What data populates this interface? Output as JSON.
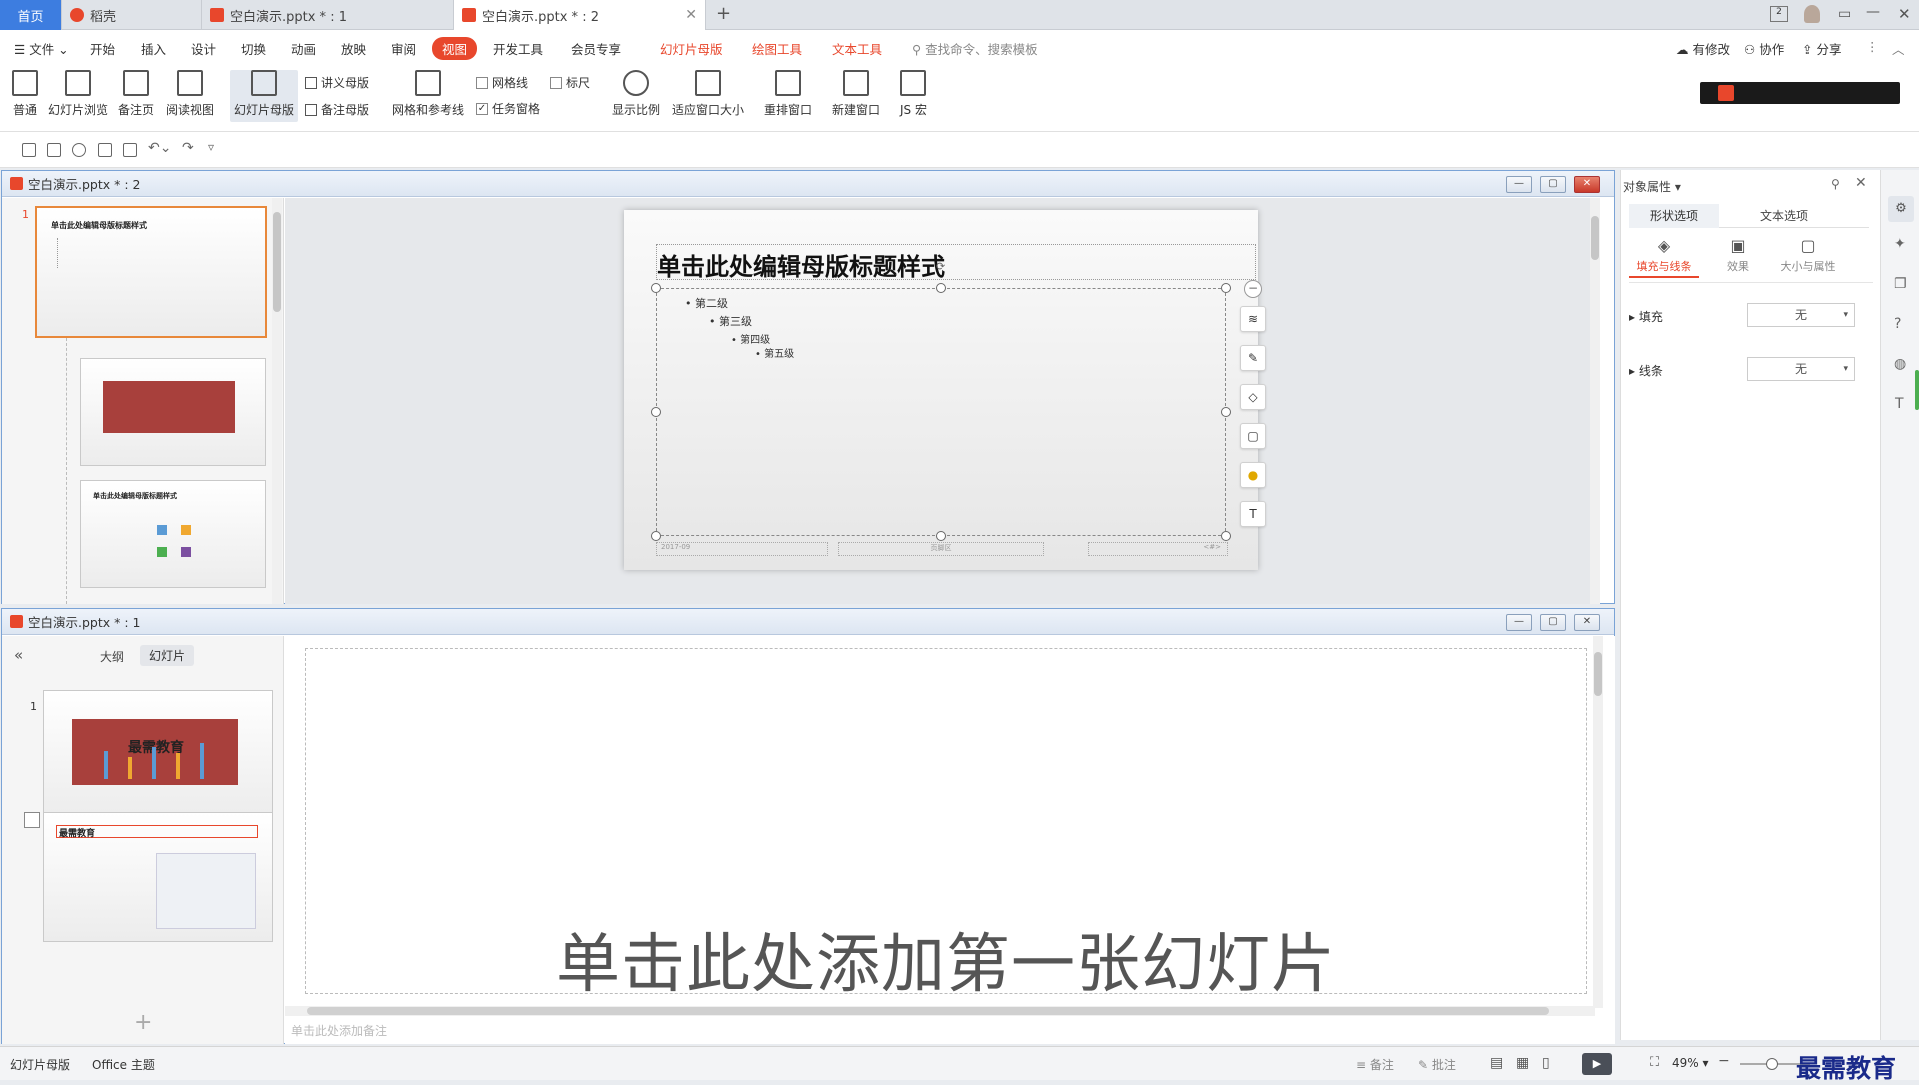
{
  "tabs": {
    "home": "首页",
    "daoke": "稻壳",
    "file1": "空白演示.pptx * : 1",
    "file2": "空白演示.pptx * : 2"
  },
  "menu": {
    "file": "文件",
    "items": [
      "开始",
      "插入",
      "设计",
      "切换",
      "动画",
      "放映",
      "审阅"
    ],
    "view": "视图",
    "dev": "开发工具",
    "member": "会员专享",
    "slide_master": "幻灯片母版",
    "draw_tools": "绘图工具",
    "text_tools": "文本工具",
    "search_placeholder": "查找命令、搜索模板",
    "modified": "有修改",
    "collab": "协作",
    "share": "分享"
  },
  "ribbon": {
    "normal": "普通",
    "slide_browse": "幻灯片浏览",
    "notes_page": "备注页",
    "reading_view": "阅读视图",
    "slide_master": "幻灯片母版",
    "handout_master": "讲义母版",
    "notes_master": "备注母版",
    "grid_guides": "网格和参考线",
    "gridlines": "网格线",
    "ruler": "标尺",
    "task_pane": "任务窗格",
    "zoom": "显示比例",
    "fit_window": "适应窗口大小",
    "arrange": "重排窗口",
    "new_window": "新建窗口",
    "js_macro": "JS 宏"
  },
  "win1": {
    "title": "空白演示.pptx * : 2",
    "slide_num": "1",
    "master_title": "单击此处编辑母版标题样式",
    "levels": [
      "第二级",
      "第三级",
      "第四级",
      "第五级"
    ],
    "footer_date": "2017-09",
    "footer_mid": "页脚区",
    "footer_num": "<#>",
    "thumb_title": "单击此处编辑母版标题样式",
    "thumb3_title": "单击此处编辑母版标题样式"
  },
  "win2": {
    "title": "空白演示.pptx * : 1",
    "tab_outline": "大纲",
    "tab_slides": "幻灯片",
    "slide_num": "1",
    "thumb1_text": "最需教育",
    "thumb2_title": "最需教育",
    "add_first": "单击此处添加第一张幻灯片",
    "notes_placeholder": "单击此处添加备注"
  },
  "panel": {
    "title": "对象属性",
    "tab_shape": "形状选项",
    "tab_text": "文本选项",
    "fill_line": "填充与线条",
    "effect": "效果",
    "size_prop": "大小与属性",
    "fill": "填充",
    "fill_value": "无",
    "line": "线条",
    "line_value": "无"
  },
  "status": {
    "mode": "幻灯片母版",
    "theme": "Office 主题",
    "notes": "备注",
    "comments": "批注",
    "zoom": "49%",
    "watermark": "最需教育"
  },
  "colors": {
    "accent": "#e8472c",
    "tab_blue": "#3d7de0",
    "slide_red": "#a8403c"
  }
}
